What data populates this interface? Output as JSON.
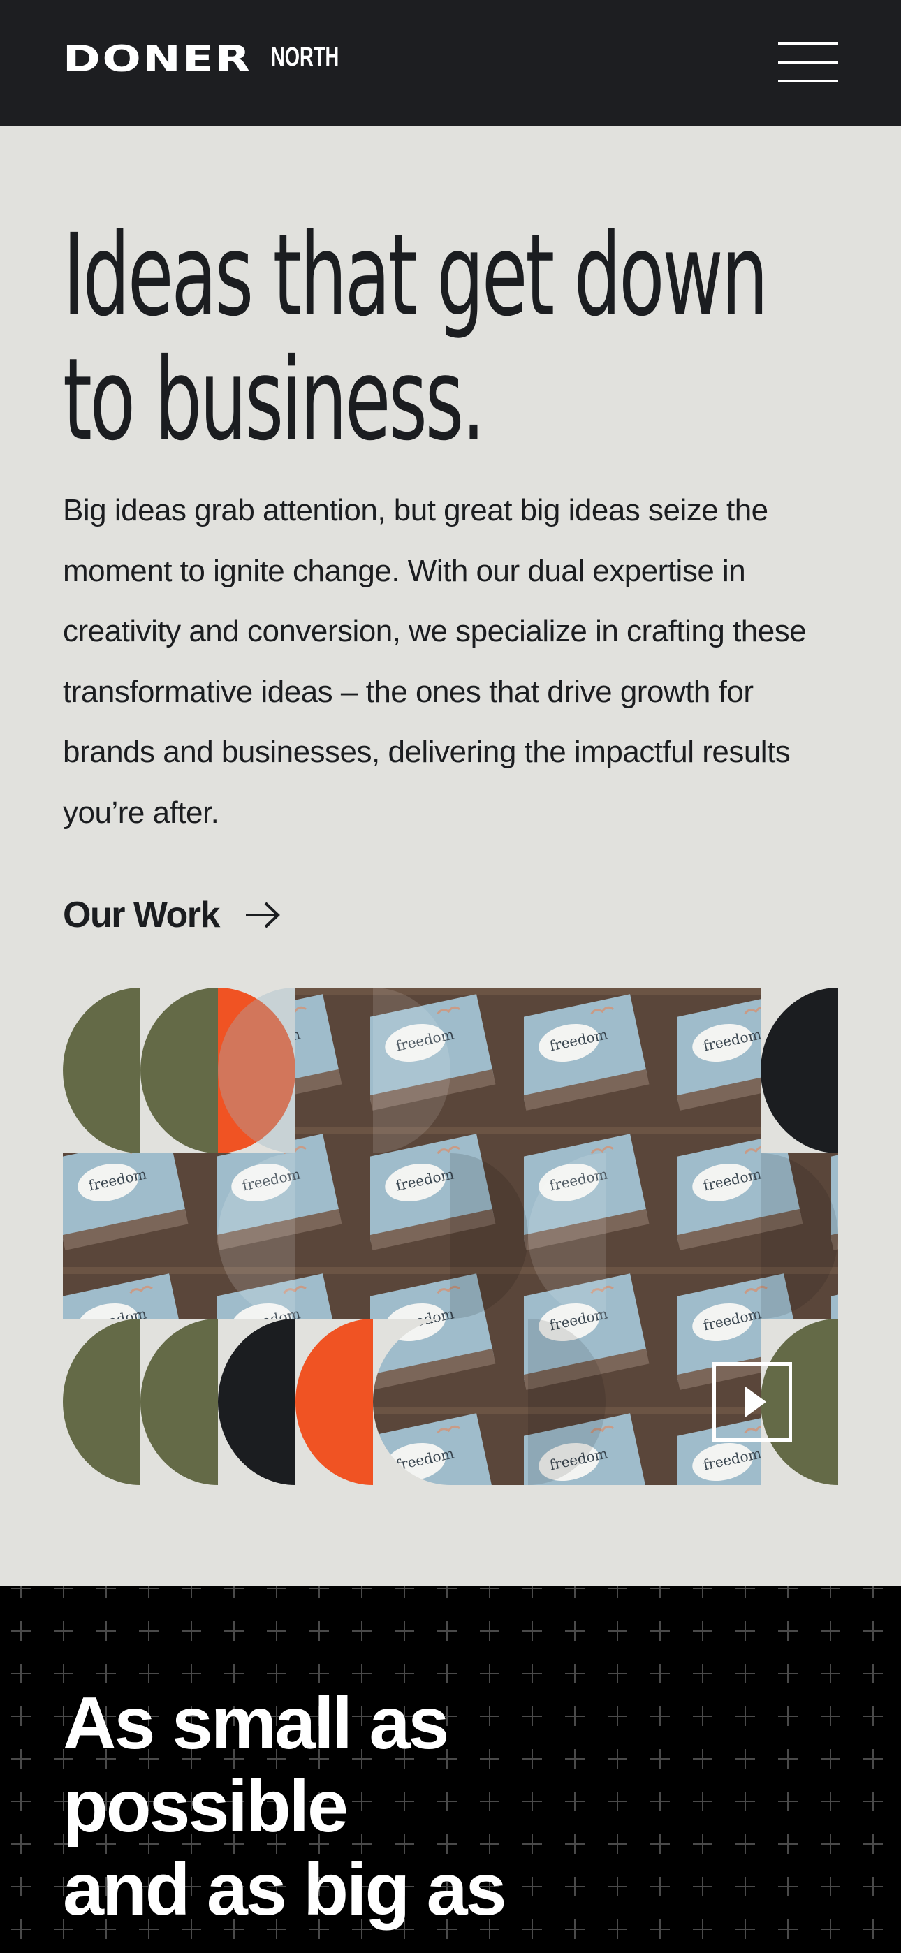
{
  "header": {
    "logo_main": "DONER",
    "logo_sub": "NORTH",
    "menu_icon": "hamburger-menu-icon"
  },
  "hero": {
    "headline_line1": "Ideas that get down",
    "headline_line2": "to business.",
    "intro": "Big ideas grab attention, but great big ideas seize the moment to ignite change. With our dual expertise in creativity and conversion, we specialize in crafting these transformative ideas – the ones that drive growth for brands and businesses, delivering the impactful results you’re after.",
    "cta_label": "Our Work",
    "cta_icon": "arrow-right-icon"
  },
  "mosaic": {
    "colors": {
      "olive": "#646a47",
      "orange": "#f05323",
      "charcoal": "#1b1d20",
      "box_blue": "#9bb7c5",
      "wood": "#5a463a"
    },
    "image_alt": "freedom tampons packaging boxes",
    "brand_text": "freedom",
    "play_icon": "play-icon"
  },
  "band": {
    "heading_line1": "As small as",
    "heading_line2": "possible",
    "heading_line3": "and as big as"
  },
  "colors": {
    "header_bg": "#1d1e21",
    "hero_bg": "#e1e1dd",
    "text_dark": "#1b1d20",
    "band_bg": "#000000"
  }
}
